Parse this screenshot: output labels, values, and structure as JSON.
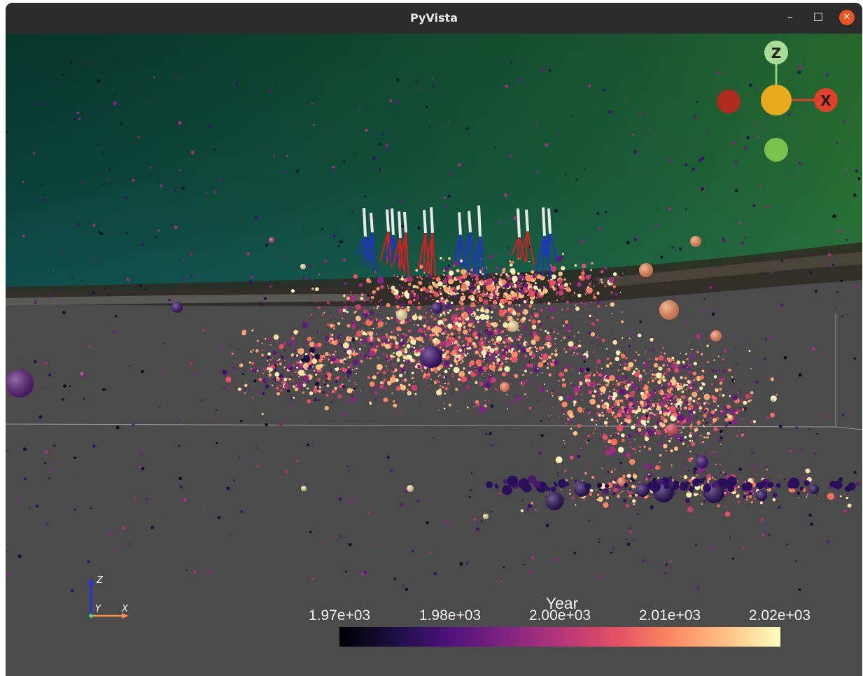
{
  "window": {
    "title": "PyVista",
    "minimize_glyph": "–",
    "maximize_glyph": "☐",
    "close_glyph": "✕"
  },
  "orientation_widget": {
    "z_label": "Z",
    "x_label": "X",
    "colors": {
      "z": "#8fd17a",
      "x": "#e2402b",
      "neg_x": "#b02a1e",
      "origin": "#e8a91c",
      "neg_y": "#7ac24c"
    }
  },
  "axes_triad": {
    "z_label": "Z",
    "y_label": "Y",
    "x_label": "X"
  },
  "colorbar": {
    "title": "Year",
    "ticks": [
      "1.97e+03",
      "1.98e+03",
      "2.00e+03",
      "2.01e+03",
      "2.02e+03"
    ],
    "colormap": "magma"
  },
  "scene_colors": {
    "background": "#4b4b4b",
    "surface_top": "#0a3a2a",
    "surface_bottom": "#0e4a4a",
    "well_top": "#e8e8e8",
    "well_blue": "#2233cc",
    "well_red": "#cc2222"
  }
}
